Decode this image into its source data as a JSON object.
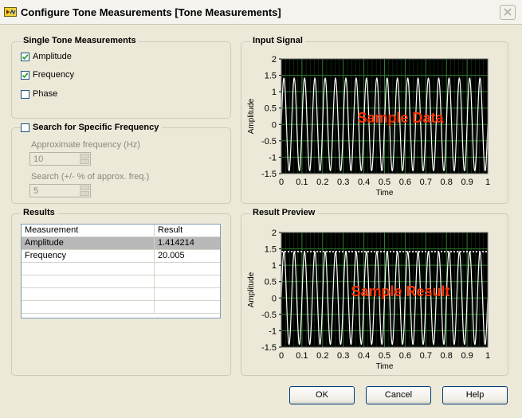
{
  "window": {
    "title": "Configure Tone Measurements [Tone Measurements]"
  },
  "single_tone": {
    "title": "Single Tone Measurements",
    "items": [
      {
        "label": "Amplitude",
        "checked": true
      },
      {
        "label": "Frequency",
        "checked": true
      },
      {
        "label": "Phase",
        "checked": false
      }
    ]
  },
  "search": {
    "title": "Search for Specific Frequency",
    "checked": false,
    "approx_label": "Approximate frequency (Hz)",
    "approx_value": "10",
    "range_label": "Search (+/- % of approx. freq.)",
    "range_value": "5"
  },
  "results": {
    "title": "Results",
    "columns": [
      "Measurement",
      "Result"
    ],
    "rows": [
      {
        "measurement": "Amplitude",
        "result": "1.414214"
      },
      {
        "measurement": "Frequency",
        "result": "20.005"
      }
    ],
    "selected_row": 0
  },
  "input_signal": {
    "title": "Input Signal",
    "overlay": "Sample Data"
  },
  "result_preview": {
    "title": "Result Preview",
    "overlay": "Sample Result"
  },
  "chart_data": [
    {
      "type": "line",
      "title": "Input Signal",
      "xlabel": "Time",
      "ylabel": "Amplitude",
      "xlim": [
        0,
        1
      ],
      "ylim": [
        -1.5,
        2
      ],
      "xticks": [
        "0",
        "0.1",
        "0.2",
        "0.3",
        "0.4",
        "0.5",
        "0.6",
        "0.7",
        "0.8",
        "0.9",
        "1"
      ],
      "yticks": [
        "-1.5",
        "-1",
        "-0.5",
        "0",
        "0.5",
        "1",
        "1.5",
        "2"
      ],
      "grid": true,
      "series": [
        {
          "kind": "sine",
          "amplitude": 1.414214,
          "frequency": 20,
          "color": "#ffffff"
        }
      ]
    },
    {
      "type": "line",
      "title": "Result Preview",
      "xlabel": "Time",
      "ylabel": "Amplitude",
      "xlim": [
        0,
        1
      ],
      "ylim": [
        -1.5,
        2
      ],
      "xticks": [
        "0",
        "0.1",
        "0.2",
        "0.3",
        "0.4",
        "0.5",
        "0.6",
        "0.7",
        "0.8",
        "0.9",
        "1"
      ],
      "yticks": [
        "-1.5",
        "-1",
        "-0.5",
        "0",
        "0.5",
        "1",
        "1.5",
        "2"
      ],
      "grid": true,
      "series": [
        {
          "kind": "sine",
          "amplitude": 1.414214,
          "frequency": 20,
          "color": "#ffffff"
        },
        {
          "kind": "constant",
          "value": 1.414214,
          "color": "#ffffff",
          "dashed": true
        }
      ]
    }
  ],
  "buttons": {
    "ok": "OK",
    "cancel": "Cancel",
    "help": "Help"
  },
  "colors": {
    "plot_background": "#000000",
    "grid": "#2e7d2e",
    "overlay_text": "#ff3300",
    "selection": "#b9b9b9"
  }
}
